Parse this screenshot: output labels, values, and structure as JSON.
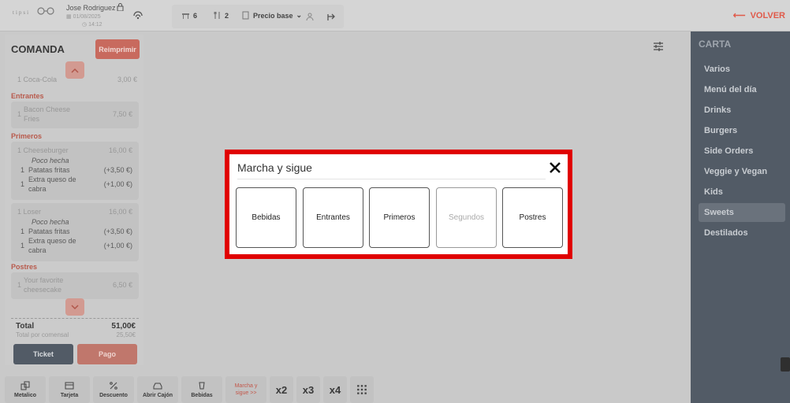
{
  "topbar": {
    "logo_text": "tipsi",
    "user_name": "Jose Rodriguez",
    "date": "01/08/2025",
    "time": "14:12",
    "diners_count": "6",
    "covers_count": "2",
    "price_label": "Precio base",
    "back_label": "VOLVER"
  },
  "comanda": {
    "title": "COMANDA",
    "reprint_label": "Reimprimir",
    "top_item": {
      "qty": "1",
      "name": "Coca-Cola",
      "price": "3,00 €"
    },
    "categories": [
      {
        "name": "Entrantes"
      },
      {
        "name": "Primeros"
      },
      {
        "name": "Postres"
      }
    ],
    "entrantes_item": {
      "qty": "1",
      "name_line1": "Bacon Cheese",
      "name_line2": "Fries",
      "price": "7,50 €"
    },
    "cheeseburger": {
      "qty": "1",
      "name": "Cheeseburger",
      "price": "16,00 €",
      "note": "Poco hecha",
      "mod1_qty": "1",
      "mod1_name": "Patatas fritas",
      "mod1_price": "(+3,50 €)",
      "mod2_qty": "1",
      "mod2_name_line1": "Extra queso de",
      "mod2_name_line2": "cabra",
      "mod2_price": "(+1,00 €)"
    },
    "loser": {
      "qty": "1",
      "name": "Loser",
      "price": "16,00 €",
      "note": "Poco hecha",
      "mod1_qty": "1",
      "mod1_name": "Patatas fritas",
      "mod1_price": "(+3,50 €)",
      "mod2_qty": "1",
      "mod2_name_line1": "Extra queso de",
      "mod2_name_line2": "cabra",
      "mod2_price": "(+1,00 €)"
    },
    "postres_item": {
      "qty": "1",
      "name_line1": "Your favorite",
      "name_line2": "cheesecake",
      "price": "6,50 €"
    },
    "total_label": "Total",
    "total_value": "51,00€",
    "per_diner_label": "Total por comensal",
    "per_diner_value": "25,50€",
    "ticket_label": "Ticket",
    "pay_label": "Pago"
  },
  "bottombar": {
    "items": [
      {
        "label": "Metalico",
        "icon": "cash-icon"
      },
      {
        "label": "Tarjeta",
        "icon": "card-icon"
      },
      {
        "label": "Descuento",
        "icon": "percent-icon"
      },
      {
        "label": "Abrir Cajón",
        "icon": "drawer-icon"
      },
      {
        "label": "Bebidas",
        "icon": "drink-icon"
      }
    ],
    "marcha_line1": "Marcha y",
    "marcha_line2": "sigue >>",
    "multipliers": [
      "x2",
      "x3",
      "x4"
    ]
  },
  "carta": {
    "title": "CARTA",
    "items": [
      "Varios",
      "Menú del día",
      "Drinks",
      "Burgers",
      "Side Orders",
      "Veggie y Vegan",
      "Kids",
      "Sweets",
      "Destilados"
    ],
    "active_item": "Sweets"
  },
  "modal": {
    "title": "Marcha y sigue",
    "courses": [
      {
        "label": "Bebidas",
        "enabled": true
      },
      {
        "label": "Entrantes",
        "enabled": true
      },
      {
        "label": "Primeros",
        "enabled": true
      },
      {
        "label": "Segundos",
        "enabled": false
      },
      {
        "label": "Postres",
        "enabled": true
      }
    ],
    "highlight_color": "#e00000"
  },
  "colors": {
    "accent_red": "#e05a4a",
    "category_red": "#b85a4c",
    "sidebar_dark": "#525b66"
  }
}
